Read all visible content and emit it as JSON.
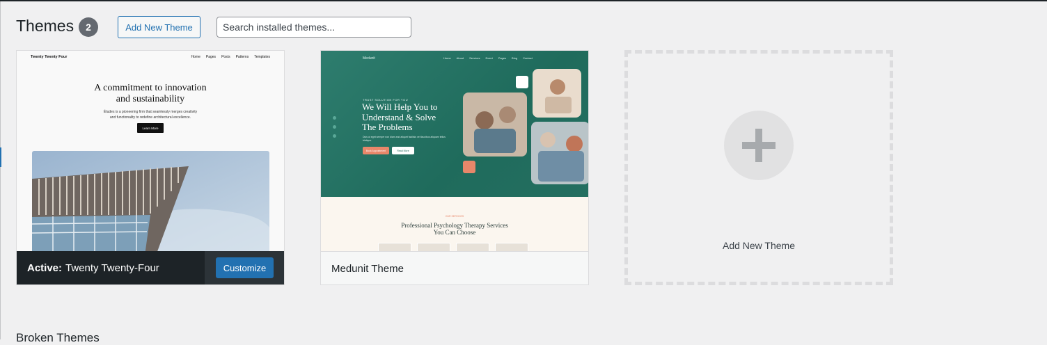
{
  "header": {
    "title": "Themes",
    "count": "2",
    "add_new_label": "Add New Theme",
    "search_placeholder": "Search installed themes..."
  },
  "themes": [
    {
      "name": "Twenty Twenty-Four",
      "active_prefix": "Active:",
      "customize_label": "Customize",
      "preview": {
        "brand": "Twenty Twenty Four",
        "nav": [
          "Home",
          "Pages",
          "Posts",
          "Patterns",
          "Templates"
        ],
        "headline_1": "A commitment to innovation",
        "headline_2": "and sustainability",
        "sub_1": "Études is a pioneering firm that seamlessly merges creativity",
        "sub_2": "and functionality to redefine architectural excellence.",
        "button": "Learn More"
      }
    },
    {
      "name": "Medunit Theme",
      "preview": {
        "brand": "Medunit",
        "nav": [
          "Home",
          "About",
          "Services",
          "Event",
          "Pages",
          "Blog",
          "Contact"
        ],
        "kicker": "TRUST SOLUTION FOR YOU",
        "headline_1": "We Will Help You to",
        "headline_2": "Understand & Solve",
        "headline_3": "The Problems",
        "body": "Duis ut eget semper non diam and aliquet facilisis vel faucibus aliquam tellus tristique.",
        "button_primary": "Book Appointment",
        "button_secondary": "Read More",
        "section_kicker": "OUR SERVICES",
        "section_title_1": "Professional Psychology Therapy Services",
        "section_title_2": "You Can Choose"
      }
    }
  ],
  "add_tile": {
    "label": "Add New Theme",
    "icon": "plus-icon"
  },
  "broken_title": "Broken Themes",
  "colors": {
    "accent": "#2271b1",
    "active_footer": "#1d2327",
    "badge": "#646970",
    "medunit_green": "#2e7d6e",
    "medunit_orange": "#e8876a"
  }
}
